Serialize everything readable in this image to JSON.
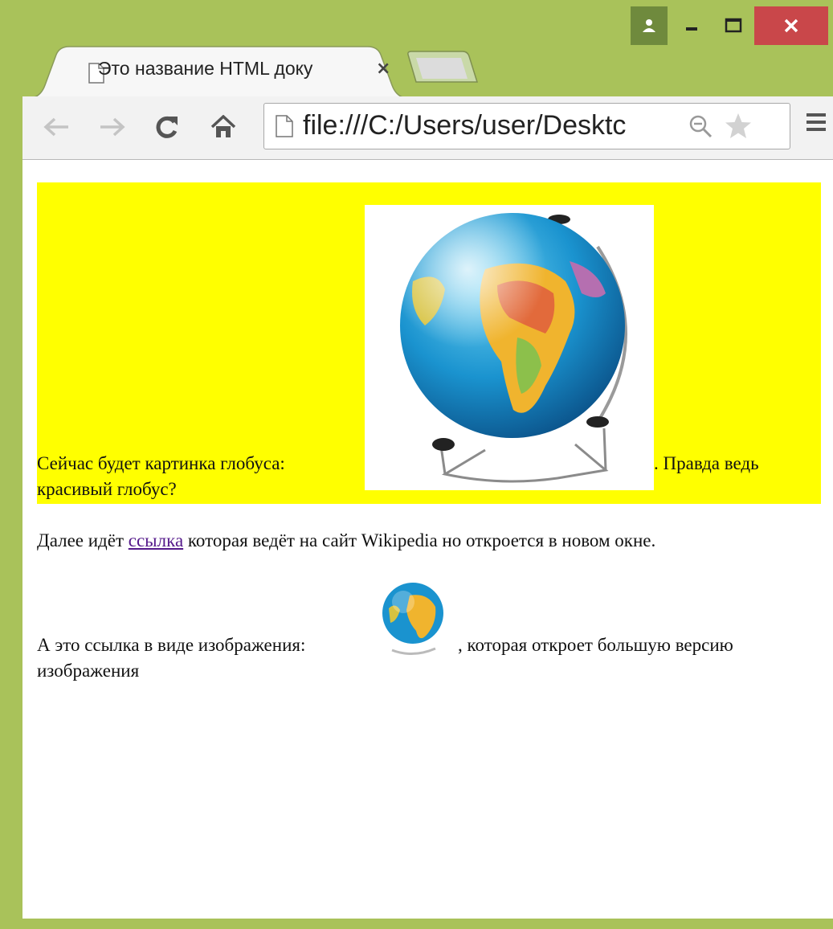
{
  "tab": {
    "title": "Это название HTML доку",
    "close": "×"
  },
  "toolbar": {
    "url": "file:///C:/Users/user/Desktc"
  },
  "page": {
    "caption_before": "Сейчас будет картинка глобуса:",
    "caption_after": ". Правда ведь",
    "caption_line2": "красивый глобус?",
    "para1_before": "Далее идёт",
    "para1_link": "ссылка",
    "para1_after": "которая ведёт на сайт Wikipedia но откроется в новом окне.",
    "para2_before": "А это ссылка в виде изображения:",
    "para2_after": ", которая откроет большую версию",
    "para2_line2": "изображения"
  },
  "colors": {
    "frame": "#a9c25a",
    "highlight": "#ffff00",
    "link": "#551a8b",
    "close_button": "#c9474a"
  },
  "icons": [
    "user-icon",
    "minimize-icon",
    "maximize-icon",
    "close-icon",
    "page-icon",
    "back-arrow-icon",
    "forward-arrow-icon",
    "reload-icon",
    "home-icon",
    "zoom-icon",
    "star-icon",
    "menu-icon",
    "globe-image",
    "globe-thumbnail"
  ]
}
